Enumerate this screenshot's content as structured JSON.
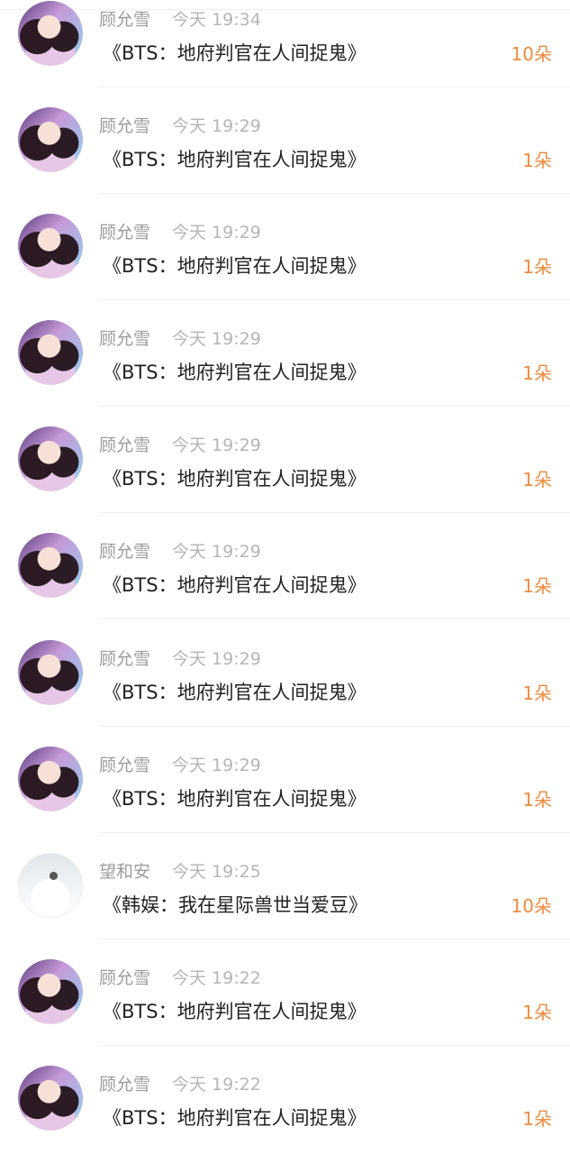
{
  "items": [
    {
      "user": "顾允雪",
      "time": "今天 19:34",
      "book": "《BTS：地府判官在人间捉鬼》",
      "amount": "10朵",
      "avatar": "girl-avatar"
    },
    {
      "user": "顾允雪",
      "time": "今天 19:29",
      "book": "《BTS：地府判官在人间捉鬼》",
      "amount": "1朵",
      "avatar": "girl-avatar"
    },
    {
      "user": "顾允雪",
      "time": "今天 19:29",
      "book": "《BTS：地府判官在人间捉鬼》",
      "amount": "1朵",
      "avatar": "girl-avatar"
    },
    {
      "user": "顾允雪",
      "time": "今天 19:29",
      "book": "《BTS：地府判官在人间捉鬼》",
      "amount": "1朵",
      "avatar": "girl-avatar"
    },
    {
      "user": "顾允雪",
      "time": "今天 19:29",
      "book": "《BTS：地府判官在人间捉鬼》",
      "amount": "1朵",
      "avatar": "girl-avatar"
    },
    {
      "user": "顾允雪",
      "time": "今天 19:29",
      "book": "《BTS：地府判官在人间捉鬼》",
      "amount": "1朵",
      "avatar": "girl-avatar"
    },
    {
      "user": "顾允雪",
      "time": "今天 19:29",
      "book": "《BTS：地府判官在人间捉鬼》",
      "amount": "1朵",
      "avatar": "girl-avatar"
    },
    {
      "user": "顾允雪",
      "time": "今天 19:29",
      "book": "《BTS：地府判官在人间捉鬼》",
      "amount": "1朵",
      "avatar": "girl-avatar"
    },
    {
      "user": "望和安",
      "time": "今天 19:25",
      "book": "《韩娱：我在星际兽世当爱豆》",
      "amount": "10朵",
      "avatar": "mist-avatar"
    },
    {
      "user": "顾允雪",
      "time": "今天 19:22",
      "book": "《BTS：地府判官在人间捉鬼》",
      "amount": "1朵",
      "avatar": "girl-avatar"
    },
    {
      "user": "顾允雪",
      "time": "今天 19:22",
      "book": "《BTS：地府判官在人间捉鬼》",
      "amount": "1朵",
      "avatar": "girl-avatar"
    }
  ]
}
